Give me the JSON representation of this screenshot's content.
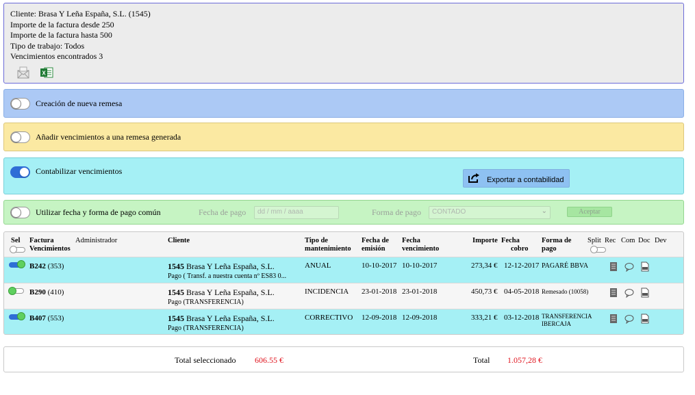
{
  "info": {
    "cliente": "Cliente: Brasa Y Leña España, S.L. (1545)",
    "importe_desde": "Importe de la factura desde 250",
    "importe_hasta": "Importe de la factura hasta 500",
    "tipo_trabajo": "Tipo de trabajo: Todos",
    "vencimientos": "Vencimientos encontrados 3",
    "icons": [
      "envelope-icon",
      "excel-icon"
    ]
  },
  "remesa": {
    "label": "Creación de nueva remesa",
    "on": false
  },
  "anadir": {
    "label": "Añadir vencimientos a una remesa generada",
    "on": false
  },
  "contabilizar": {
    "label": "Contabilizar vencimientos",
    "on": true,
    "export_label": "Exportar a contabilidad"
  },
  "fecha_comun": {
    "label": "Utilizar fecha y forma de pago común",
    "on": false,
    "fecha_label": "Fecha de pago",
    "fecha_placeholder": "dd / mm / aaaa",
    "forma_label": "Forma de pago",
    "forma_value": "CONTADO",
    "aceptar": "Aceptar"
  },
  "table": {
    "headers": {
      "sel": "Sel",
      "factura": "Factura",
      "vencimientos": "Vencimientos",
      "administrador": "Administrador",
      "cliente": "Cliente",
      "tipo1": "Tipo de",
      "tipo2": "mantenimiento",
      "emision1": "Fecha de",
      "emision2": "emisión",
      "venc1": "Fecha",
      "venc2": "vencimiento",
      "importe": "Importe",
      "cobro1": "Fecha",
      "cobro2": "cobro",
      "forma1": "Forma de",
      "forma2": "pago",
      "split": "Split",
      "rec": "Rec",
      "com": "Com",
      "doc": "Doc",
      "dev": "Dev"
    },
    "rows": [
      {
        "selected": true,
        "factura": "B242",
        "venc": "(353)",
        "cliente_code": "1545",
        "cliente_name": "Brasa Y Leña España, S.L.",
        "pago": "Pago ( Transf. a nuestra cuenta nº ES83 0...",
        "tipo": "ANUAL",
        "emision": "10-10-2017",
        "vencimiento": "10-10-2017",
        "importe": "273,34 €",
        "cobro": "12-12-2017",
        "forma1": "PAGARÉ BBVA",
        "forma2": ""
      },
      {
        "selected": false,
        "factura": "B290",
        "venc": "(410)",
        "cliente_code": "1545",
        "cliente_name": "Brasa Y Leña España, S.L.",
        "pago": "Pago (TRANSFERENCIA)",
        "tipo": "INCIDENCIA",
        "emision": "23-01-2018",
        "vencimiento": "23-01-2018",
        "importe": "450,73 €",
        "cobro": "04-05-2018",
        "forma1": "Remesado (10058)",
        "forma2": ""
      },
      {
        "selected": true,
        "factura": "B407",
        "venc": "(553)",
        "cliente_code": "1545",
        "cliente_name": "Brasa Y Leña España, S.L.",
        "pago": "Pago (TRANSFERENCIA)",
        "tipo": "CORRECTIVO",
        "emision": "12-09-2018",
        "vencimiento": "12-09-2018",
        "importe": "333,21 €",
        "cobro": "03-12-2018",
        "forma1": "TRANSFERENCIA",
        "forma2": "IBERCAJA"
      }
    ]
  },
  "totals": {
    "selected_label": "Total seleccionado",
    "selected_value": "606.55 €",
    "total_label": "Total",
    "total_value": "1.057,28 €",
    "accent": "#e0141e"
  }
}
